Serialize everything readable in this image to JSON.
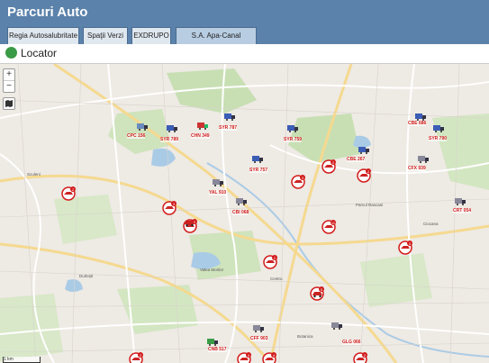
{
  "app": {
    "title": "Parcuri Auto"
  },
  "tabs": [
    {
      "label": "Regia Autosalubritate"
    },
    {
      "label": "Spaţii Verzi"
    },
    {
      "label": "EXDRUPO"
    },
    {
      "label": "S.A. Apa-Canal Chisinau"
    }
  ],
  "locator": {
    "label": "Locator"
  },
  "map": {
    "zoom_in": "+",
    "zoom_out": "−",
    "scale": "1 km",
    "places": [
      "Durlești",
      "Sculeni",
      "Parcul Rascani",
      "Valea Morilor",
      "Botanica",
      "Centru",
      "Ciocana"
    ],
    "vehicles": [
      {
        "label": "CPC 156"
      },
      {
        "label": "SYR 789"
      },
      {
        "label": "CHN 349"
      },
      {
        "label": "SYR 787"
      },
      {
        "label": "SYR 759"
      },
      {
        "label": "CBE 686"
      },
      {
        "label": "SYR 790"
      },
      {
        "label": "CBE 267"
      },
      {
        "label": "SYR 757"
      },
      {
        "label": "CFX 939"
      },
      {
        "label": "YAL 910"
      },
      {
        "label": "CBI 068"
      },
      {
        "label": "CRT 054"
      },
      {
        "label": "CFF 903"
      },
      {
        "label": "GLG 066"
      },
      {
        "label": "CNB 517"
      }
    ],
    "clusters": [
      "2",
      "3",
      "2",
      "3",
      "2",
      "2",
      "2",
      "11",
      "3",
      "5",
      "4",
      "4",
      "2",
      "2"
    ]
  }
}
